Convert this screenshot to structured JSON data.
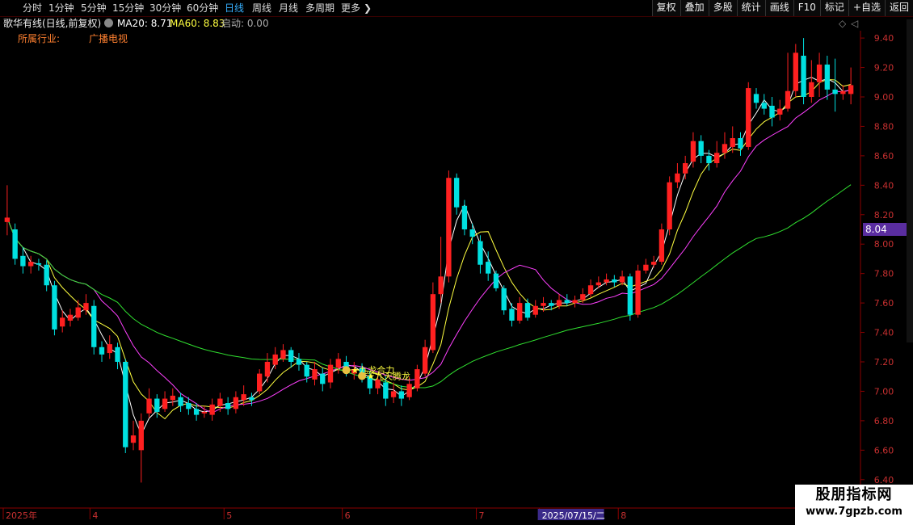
{
  "toolbar": {
    "periods": [
      "分时",
      "1分钟",
      "5分钟",
      "15分钟",
      "30分钟",
      "60分钟",
      "日线",
      "周线",
      "月线",
      "多周期",
      "更多"
    ],
    "active_period": "日线",
    "more_arrow": "❯",
    "right_buttons": [
      "复权",
      "叠加",
      "多股",
      "统计",
      "画线",
      "F10",
      "标记",
      "+自选",
      "返回"
    ]
  },
  "info": {
    "title": "歌华有线(日线,前复权)",
    "ma20_label": "MA20: 8.71",
    "ma60_label": "MA60: 8.83",
    "start_label": "启动: 0.00"
  },
  "industry": {
    "label": "所属行业:",
    "value": "广播电视"
  },
  "signals": [
    {
      "text": "★九龙合力",
      "index": 43
    },
    {
      "text": "★九天腾龙",
      "index": 45
    }
  ],
  "price_marker": "8.04",
  "axis": {
    "y_ticks": [
      "9.40",
      "9.20",
      "9.00",
      "8.80",
      "8.60",
      "8.40",
      "8.20",
      "8.00",
      "7.80",
      "7.60",
      "7.40",
      "7.20",
      "7.00",
      "6.80",
      "6.60",
      "6.40"
    ],
    "y_values": [
      9.4,
      9.2,
      9.0,
      8.8,
      8.6,
      8.4,
      8.2,
      8.0,
      7.8,
      7.6,
      7.4,
      7.2,
      7.0,
      6.8,
      6.6,
      6.4
    ],
    "x_labels": [
      {
        "text": "2025年",
        "index": 0
      },
      {
        "text": "4",
        "index": 11
      },
      {
        "text": "5",
        "index": 28
      },
      {
        "text": "6",
        "index": 43
      },
      {
        "text": "7",
        "index": 60
      },
      {
        "text": "2025/07/15/二",
        "index": 68,
        "highlight": true
      },
      {
        "text": "8",
        "index": 78
      }
    ]
  },
  "colors": {
    "up": "#ff2020",
    "down": "#00e0e0",
    "ma_white": "#ffffff",
    "ma_yellow": "#ffff40",
    "ma_magenta": "#ff40ff",
    "ma_green": "#30e030",
    "axis": "#8b0000",
    "active_tab": "#36b0ff"
  },
  "watermark": {
    "line1": "股朋指标网",
    "line2": "www.7gpzb.com"
  },
  "chart_data": {
    "type": "candlestick",
    "ylim": [
      6.3,
      9.45
    ],
    "candles": [
      [
        8.15,
        8.18,
        8.4,
        8.06
      ],
      [
        8.1,
        7.9,
        8.14,
        7.86
      ],
      [
        7.92,
        7.85,
        7.98,
        7.8
      ],
      [
        7.85,
        7.88,
        7.92,
        7.8
      ],
      [
        7.87,
        7.86,
        7.9,
        7.82
      ],
      [
        7.86,
        7.72,
        7.89,
        7.68
      ],
      [
        7.72,
        7.42,
        7.75,
        7.38
      ],
      [
        7.44,
        7.5,
        7.55,
        7.4
      ],
      [
        7.48,
        7.52,
        7.56,
        7.44
      ],
      [
        7.5,
        7.57,
        7.62,
        7.48
      ],
      [
        7.55,
        7.6,
        7.66,
        7.52
      ],
      [
        7.58,
        7.3,
        7.62,
        7.25
      ],
      [
        7.3,
        7.25,
        7.34,
        7.2
      ],
      [
        7.26,
        7.32,
        7.38,
        7.22
      ],
      [
        7.3,
        7.2,
        7.33,
        7.15
      ],
      [
        7.2,
        6.62,
        7.22,
        6.58
      ],
      [
        6.65,
        6.7,
        6.8,
        6.6
      ],
      [
        6.6,
        6.8,
        6.85,
        6.38
      ],
      [
        6.85,
        6.95,
        7.02,
        6.82
      ],
      [
        6.95,
        6.86,
        6.98,
        6.82
      ],
      [
        6.88,
        6.95,
        7.0,
        6.86
      ],
      [
        6.94,
        6.97,
        7.02,
        6.9
      ],
      [
        6.96,
        6.9,
        6.99,
        6.86
      ],
      [
        6.92,
        6.88,
        6.96,
        6.84
      ],
      [
        6.88,
        6.84,
        6.92,
        6.8
      ],
      [
        6.85,
        6.86,
        6.9,
        6.82
      ],
      [
        6.84,
        6.91,
        6.95,
        6.8
      ],
      [
        6.9,
        6.95,
        6.99,
        6.86
      ],
      [
        6.92,
        6.88,
        6.96,
        6.84
      ],
      [
        6.88,
        6.96,
        7.0,
        6.85
      ],
      [
        6.94,
        6.98,
        7.04,
        6.9
      ],
      [
        6.96,
        6.94,
        6.99,
        6.9
      ],
      [
        7.0,
        7.12,
        7.15,
        6.98
      ],
      [
        7.1,
        7.2,
        7.26,
        7.06
      ],
      [
        7.18,
        7.25,
        7.3,
        7.15
      ],
      [
        7.22,
        7.28,
        7.32,
        7.2
      ],
      [
        7.28,
        7.2,
        7.3,
        7.16
      ],
      [
        7.22,
        7.18,
        7.26,
        7.14
      ],
      [
        7.18,
        7.1,
        7.2,
        7.06
      ],
      [
        7.08,
        7.15,
        7.2,
        7.04
      ],
      [
        7.12,
        7.05,
        7.16,
        7.0
      ],
      [
        7.06,
        7.18,
        7.22,
        7.02
      ],
      [
        7.16,
        7.22,
        7.26,
        7.12
      ],
      [
        7.2,
        7.14,
        7.24,
        7.1
      ],
      [
        7.12,
        7.15,
        7.2,
        7.08
      ],
      [
        7.16,
        7.1,
        7.19,
        7.06
      ],
      [
        7.1,
        7.02,
        7.14,
        6.98
      ],
      [
        7.02,
        7.08,
        7.12,
        6.98
      ],
      [
        7.06,
        6.95,
        7.1,
        6.9
      ],
      [
        6.96,
        7.0,
        7.06,
        6.92
      ],
      [
        7.0,
        6.95,
        7.04,
        6.9
      ],
      [
        6.96,
        7.05,
        7.1,
        6.94
      ],
      [
        7.02,
        7.15,
        7.18,
        7.0
      ],
      [
        7.12,
        7.3,
        7.35,
        7.1
      ],
      [
        7.28,
        7.66,
        7.74,
        7.26
      ],
      [
        7.66,
        7.78,
        8.05,
        7.6
      ],
      [
        7.78,
        8.45,
        8.5,
        7.74
      ],
      [
        8.45,
        8.25,
        8.48,
        8.2
      ],
      [
        8.26,
        8.1,
        8.3,
        8.06
      ],
      [
        8.1,
        8.05,
        8.14,
        8.0
      ],
      [
        8.02,
        7.86,
        8.06,
        7.8
      ],
      [
        7.88,
        7.8,
        7.95,
        7.75
      ],
      [
        7.8,
        7.7,
        7.82,
        7.68
      ],
      [
        7.7,
        7.55,
        7.72,
        7.52
      ],
      [
        7.56,
        7.48,
        7.6,
        7.44
      ],
      [
        7.48,
        7.6,
        7.64,
        7.46
      ],
      [
        7.6,
        7.5,
        7.63,
        7.48
      ],
      [
        7.52,
        7.58,
        7.62,
        7.5
      ],
      [
        7.58,
        7.6,
        7.64,
        7.54
      ],
      [
        7.6,
        7.58,
        7.62,
        7.55
      ],
      [
        7.58,
        7.62,
        7.66,
        7.56
      ],
      [
        7.62,
        7.6,
        7.66,
        7.58
      ],
      [
        7.6,
        7.62,
        7.65,
        7.57
      ],
      [
        7.62,
        7.66,
        7.7,
        7.6
      ],
      [
        7.66,
        7.72,
        7.76,
        7.64
      ],
      [
        7.72,
        7.74,
        7.78,
        7.7
      ],
      [
        7.74,
        7.76,
        7.8,
        7.72
      ],
      [
        7.76,
        7.74,
        7.79,
        7.71
      ],
      [
        7.74,
        7.78,
        7.82,
        7.72
      ],
      [
        7.78,
        7.52,
        7.8,
        7.48
      ],
      [
        7.52,
        7.82,
        7.86,
        7.5
      ],
      [
        7.82,
        7.86,
        7.9,
        7.8
      ],
      [
        7.86,
        7.88,
        7.92,
        7.84
      ],
      [
        7.88,
        8.1,
        8.14,
        7.86
      ],
      [
        8.1,
        8.42,
        8.46,
        8.06
      ],
      [
        8.42,
        8.48,
        8.55,
        8.38
      ],
      [
        8.48,
        8.55,
        8.6,
        8.44
      ],
      [
        8.56,
        8.7,
        8.76,
        8.52
      ],
      [
        8.7,
        8.6,
        8.74,
        8.55
      ],
      [
        8.6,
        8.55,
        8.64,
        8.5
      ],
      [
        8.55,
        8.62,
        8.7,
        8.52
      ],
      [
        8.62,
        8.68,
        8.76,
        8.58
      ],
      [
        8.66,
        8.72,
        8.8,
        8.62
      ],
      [
        8.72,
        8.65,
        8.76,
        8.6
      ],
      [
        8.66,
        9.06,
        9.1,
        8.64
      ],
      [
        9.02,
        8.96,
        9.06,
        8.92
      ],
      [
        8.96,
        8.92,
        9.02,
        8.88
      ],
      [
        8.94,
        8.86,
        9.0,
        8.8
      ],
      [
        8.88,
        8.92,
        8.98,
        8.84
      ],
      [
        8.92,
        9.04,
        9.3,
        8.9
      ],
      [
        9.04,
        9.3,
        9.36,
        9.0
      ],
      [
        9.28,
        9.0,
        9.4,
        8.95
      ],
      [
        9.0,
        9.1,
        9.25,
        8.96
      ],
      [
        9.1,
        9.22,
        9.3,
        9.0
      ],
      [
        9.22,
        9.05,
        9.28,
        8.98
      ],
      [
        9.05,
        9.02,
        9.26,
        8.9
      ],
      [
        9.02,
        9.04,
        9.08,
        8.98
      ],
      [
        9.02,
        9.08,
        9.2,
        8.95
      ]
    ]
  }
}
